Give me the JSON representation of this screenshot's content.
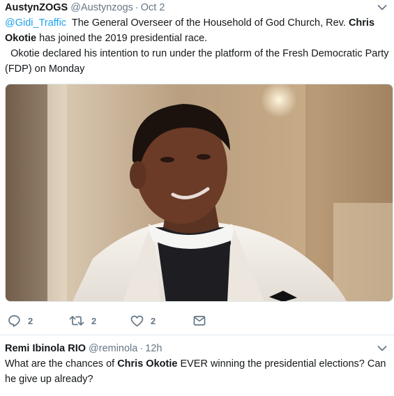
{
  "tweets": [
    {
      "name": "AustynZOGS",
      "handle": "@Austynzogs",
      "separator": "·",
      "time": "Oct 2",
      "mention": "@Gidi_Traffic",
      "text_part1": "  The General Overseer of the Household of God Church, Rev. ",
      "bold_part": "Chris Okotie",
      "text_part2": " has joined the 2019 presidential race.",
      "text_line2": "  Okotie declared his intention to run under the platform of the Fresh Democratic Party (FDP) on Monday",
      "media_icon": "photo-man-white-suit",
      "actions": {
        "reply_count": "2",
        "retweet_count": "2",
        "like_count": "2",
        "reply_icon": "reply-icon",
        "retweet_icon": "retweet-icon",
        "like_icon": "heart-icon",
        "dm_icon": "envelope-icon"
      }
    },
    {
      "name": "Remi Ibinola RIO",
      "handle": "@reminola",
      "separator": "·",
      "time": "12h",
      "text_part1": "What are the chances of ",
      "bold_part": "Chris Okotie",
      "text_part2": " EVER winning the presidential elections? Can he give up already?"
    }
  ],
  "colors": {
    "name": "#14171a",
    "secondary": "#657786",
    "link": "#1da1f2",
    "divider": "#e1e8ed"
  }
}
